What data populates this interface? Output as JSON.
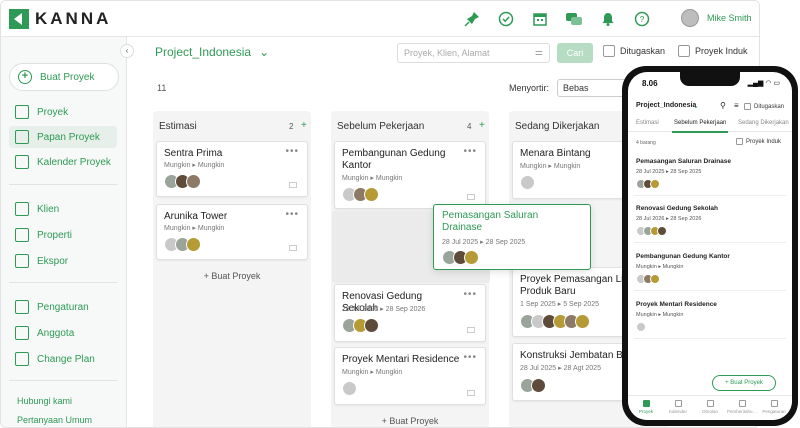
{
  "brand": {
    "name": "KANNA",
    "accent": "#2e9a55"
  },
  "header": {
    "icons": [
      "pin-icon",
      "check-circle-icon",
      "calendar-icon",
      "chat-icon",
      "bell-icon",
      "help-icon"
    ],
    "user_name": "Mike Smith"
  },
  "sidebar": {
    "new_project": "Buat Proyek",
    "items": [
      {
        "label": "Proyek",
        "icon": "list-icon"
      },
      {
        "label": "Papan Proyek",
        "icon": "board-icon",
        "active": true
      },
      {
        "label": "Kalender Proyek",
        "icon": "calendar-icon"
      },
      {
        "label": "Klien",
        "icon": "client-icon"
      },
      {
        "label": "Properti",
        "icon": "property-icon"
      },
      {
        "label": "Ekspor",
        "icon": "export-icon"
      },
      {
        "label": "Pengaturan",
        "icon": "gear-icon"
      },
      {
        "label": "Anggota",
        "icon": "user-icon"
      },
      {
        "label": "Change Plan",
        "icon": "clipboard-icon"
      }
    ],
    "links": [
      "Hubungi kami",
      "Pertanyaan Umum"
    ]
  },
  "toolbar": {
    "project_title": "Project_Indonesia",
    "search_placeholder": "Proyek, Klien, Alamat",
    "search_button": "Cari",
    "check_assigned": "Ditugaskan",
    "check_parent": "Proyek Induk",
    "total_count": "11",
    "sort_label": "Menyortir:",
    "sort_value": "Bebas"
  },
  "columns": [
    {
      "title": "Estimasi",
      "count": "2",
      "cards": [
        {
          "title": "Sentra Prima",
          "sub": "Mungkin ▸ Mungkin"
        },
        {
          "title": "Arunika Tower",
          "sub": "Mungkin ▸ Mungkin"
        }
      ],
      "add": "+ Buat Proyek"
    },
    {
      "title": "Sebelum Pekerjaan",
      "count": "4",
      "cards": [
        {
          "title": "Pembangunan Gedung Kantor",
          "sub": "Mungkin ▸ Mungkin"
        },
        {
          "title": "Renovasi Gedung Sekolah",
          "sub": "28 Jul 2026 ▸ 28 Sep 2026"
        },
        {
          "title": "Proyek Mentari Residence",
          "sub": "Mungkin ▸ Mungkin"
        }
      ],
      "add": "+ Buat Proyek"
    },
    {
      "title": "Sedang Dikerjakan",
      "cards": [
        {
          "title": "Menara Bintang",
          "sub": "Mungkin ▸ Mungkin"
        },
        {
          "title": "Proyek Pemasangan Lin Produk Baru",
          "sub": "1 Sep 2025 ▸ 5 Sep 2025"
        },
        {
          "title": "Konstruksi Jembatan B",
          "sub": "28 Jul 2025 ▸ 28 Agt 2025"
        }
      ]
    }
  ],
  "drag_card": {
    "title": "Pemasangan Saluran Drainase",
    "sub": "28 Jul 2025 ▸ 28 Sep 2025"
  },
  "phone": {
    "time": "8.06",
    "status": "▂▄▆ ◠ ▭",
    "project_title": "Project_Indonesia",
    "check_assigned": "Ditugaskan",
    "tabs": [
      "Estimasi",
      "Sebelum Pekerjaan",
      "Sedang Dikerjakan"
    ],
    "count_label": "4 barang",
    "check_parent": "Proyek Induk",
    "cards": [
      {
        "title": "Pemasangan Saluran Drainase",
        "sub": "28 Jul 2025 ▸ 28 Sep 2025"
      },
      {
        "title": "Renovasi Gedung Sekolah",
        "sub": "28 Jul 2026 ▸ 28 Sep 2026"
      },
      {
        "title": "Pembangunan Gedung Kantor",
        "sub": "Mungkin ▸ Mungkin"
      },
      {
        "title": "Proyek Mentari Residence",
        "sub": "Mungkin ▸ Mungkin"
      }
    ],
    "add_button": "+ Buat Proyek",
    "nav": [
      "Proyek",
      "Kalender",
      "Obrolan",
      "Pemberitahu…",
      "Pengaturan"
    ]
  }
}
